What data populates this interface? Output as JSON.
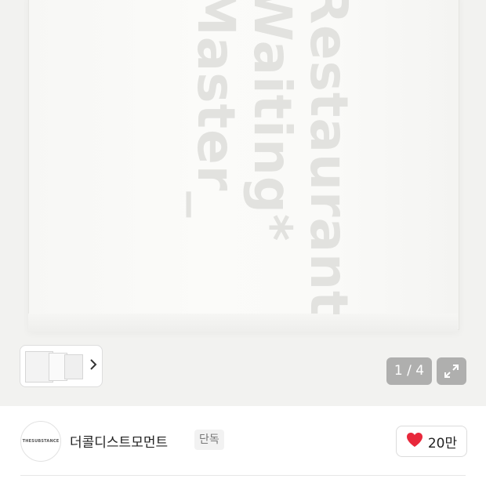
{
  "product_image": {
    "print_lines": [
      "Restaurant",
      "Waiting*",
      "Master_"
    ],
    "pager_text": "1 / 4",
    "current_index": 1,
    "total_images": 4
  },
  "seller": {
    "avatar_text": "THESUBSTANCE",
    "name": "더콜디스트모먼트",
    "badge": "단독"
  },
  "like": {
    "count": "20만"
  },
  "colors": {
    "heart": "#e8283b",
    "pager_bg": "#8a8a8a"
  }
}
